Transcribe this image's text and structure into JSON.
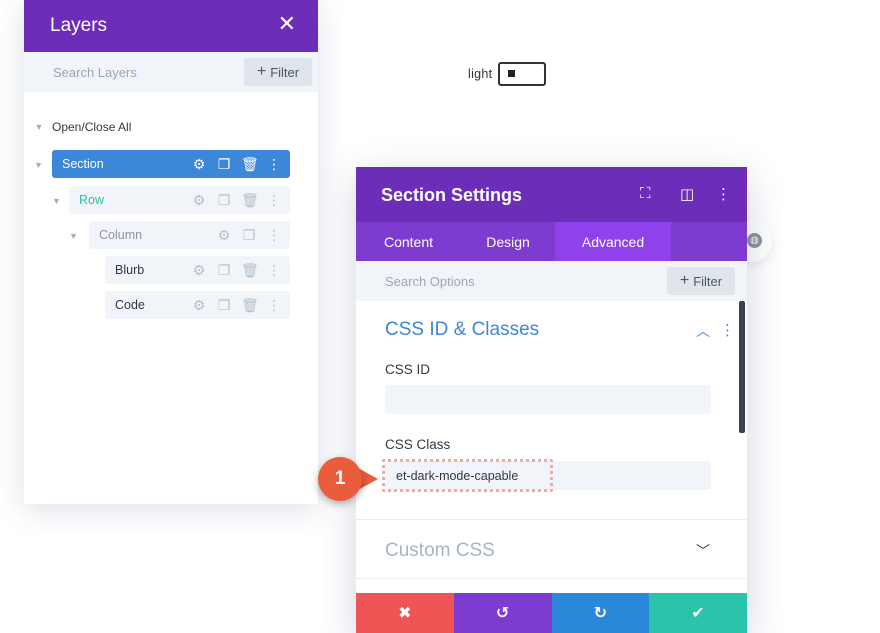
{
  "colors": {
    "purple_header": "#6c2eb9",
    "purple_tabs": "#7e3bd0",
    "purple_active_tab": "#8f42ec",
    "blue_accent": "#3d87d9",
    "teal_row": "#2ec2a4",
    "red_cancel": "#ef5555",
    "blue_redo": "#2b87da",
    "green_save": "#29c4a9",
    "badge_orange": "#ea5c3c"
  },
  "layers": {
    "title": "Layers",
    "close_icon": "close-icon",
    "search_placeholder": "Search Layers",
    "filter_label": "Filter",
    "open_close_all": "Open/Close All",
    "items": [
      {
        "label": "Section",
        "level": 0,
        "active": true
      },
      {
        "label": "Row",
        "level": 1
      },
      {
        "label": "Column",
        "level": 2
      },
      {
        "label": "Blurb",
        "level": 3
      },
      {
        "label": "Code",
        "level": 3
      }
    ],
    "item_icons": [
      "gear-icon",
      "duplicate-icon",
      "trash-icon",
      "kebab-icon"
    ]
  },
  "toggle": {
    "label": "light",
    "state": "on"
  },
  "settings": {
    "title": "Section Settings",
    "header_icons": [
      "focus-icon",
      "split-view-icon",
      "kebab-icon"
    ],
    "tabs": [
      {
        "label": "Content",
        "active": false
      },
      {
        "label": "Design",
        "active": false
      },
      {
        "label": "Advanced",
        "active": true
      }
    ],
    "search_placeholder": "Search Options",
    "filter_label": "Filter",
    "groups": [
      {
        "title": "CSS ID & Classes",
        "expanded": true,
        "fields": [
          {
            "label": "CSS ID",
            "value": ""
          },
          {
            "label": "CSS Class",
            "value": "et-dark-mode-capable"
          }
        ]
      },
      {
        "title": "Custom CSS",
        "expanded": false
      }
    ],
    "footer_buttons": [
      {
        "name": "cancel",
        "icon": "close-icon"
      },
      {
        "name": "undo",
        "icon": "undo-icon"
      },
      {
        "name": "redo",
        "icon": "redo-icon"
      },
      {
        "name": "save",
        "icon": "check-icon"
      }
    ]
  },
  "annotation": {
    "step_number": "1"
  }
}
